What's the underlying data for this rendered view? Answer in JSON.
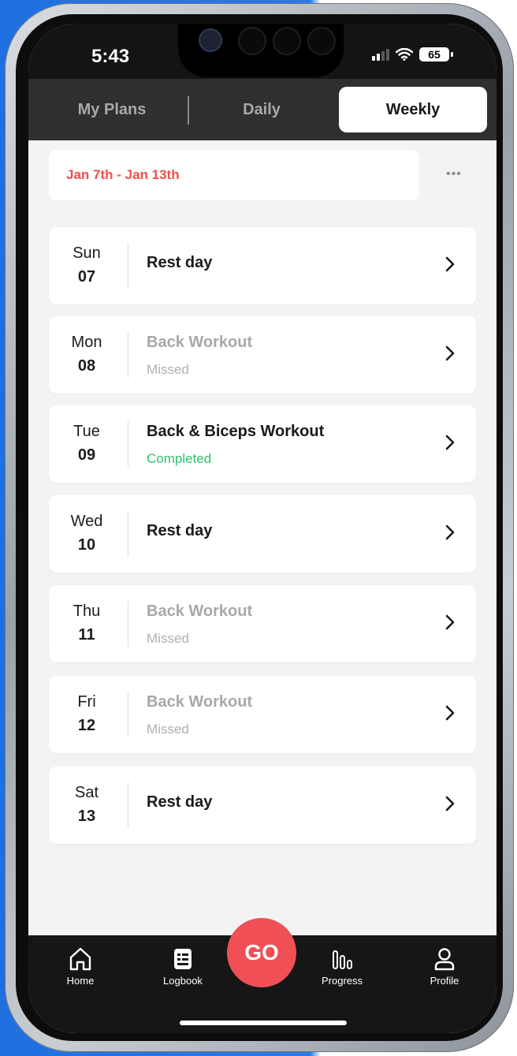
{
  "status_bar": {
    "time": "5:43",
    "battery": "65"
  },
  "tabs": [
    {
      "label": "My Plans",
      "active": false
    },
    {
      "label": "Daily",
      "active": false
    },
    {
      "label": "Weekly",
      "active": true
    }
  ],
  "date_range": "Jan 7th - Jan 13th",
  "days": [
    {
      "day": "Sun",
      "date": "07",
      "title": "Rest day",
      "status": ""
    },
    {
      "day": "Mon",
      "date": "08",
      "title": "Back Workout",
      "status": "Missed"
    },
    {
      "day": "Tue",
      "date": "09",
      "title": "Back & Biceps Workout",
      "status": "Completed"
    },
    {
      "day": "Wed",
      "date": "10",
      "title": "Rest day",
      "status": ""
    },
    {
      "day": "Thu",
      "date": "11",
      "title": "Back Workout",
      "status": "Missed"
    },
    {
      "day": "Fri",
      "date": "12",
      "title": "Back Workout",
      "status": "Missed"
    },
    {
      "day": "Sat",
      "date": "13",
      "title": "Rest day",
      "status": ""
    }
  ],
  "nav": {
    "home": "Home",
    "logbook": "Logbook",
    "go": "GO",
    "progress": "Progress",
    "profile": "Profile"
  },
  "colors": {
    "accent_red": "#f04f55",
    "date_red": "#f14e4e",
    "completed_green": "#2ec26d",
    "missed_gray": "#a8a8a8"
  }
}
